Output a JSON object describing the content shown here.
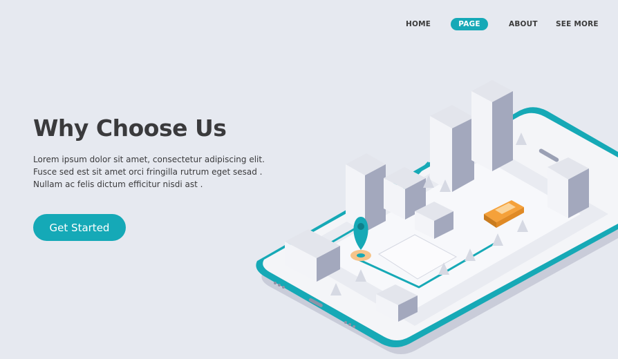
{
  "nav": {
    "items": [
      {
        "label": "HOME",
        "active": false
      },
      {
        "label": "PAGE",
        "active": true
      },
      {
        "label": "ABOUT",
        "active": false
      },
      {
        "label": "SEE MORE",
        "active": false
      }
    ]
  },
  "hero": {
    "title": "Why Choose Us",
    "lines": [
      "Lorem ipsum dolor sit amet, consectetur adipiscing elit.",
      "Fusce sed est sit amet orci fringilla rutrum eget sesad .",
      "Nullam ac felis dictum efficitur nisdi ast ."
    ],
    "cta_label": "Get Started"
  },
  "colors": {
    "background": "#e6e9f0",
    "accent": "#15a9b7",
    "text": "#3a3a3c",
    "car": "#f5a13a"
  },
  "illustration": {
    "icons": [
      "smartphone-icon",
      "map-pin-icon",
      "taxi-car-icon",
      "building-icon",
      "tree-icon"
    ]
  }
}
